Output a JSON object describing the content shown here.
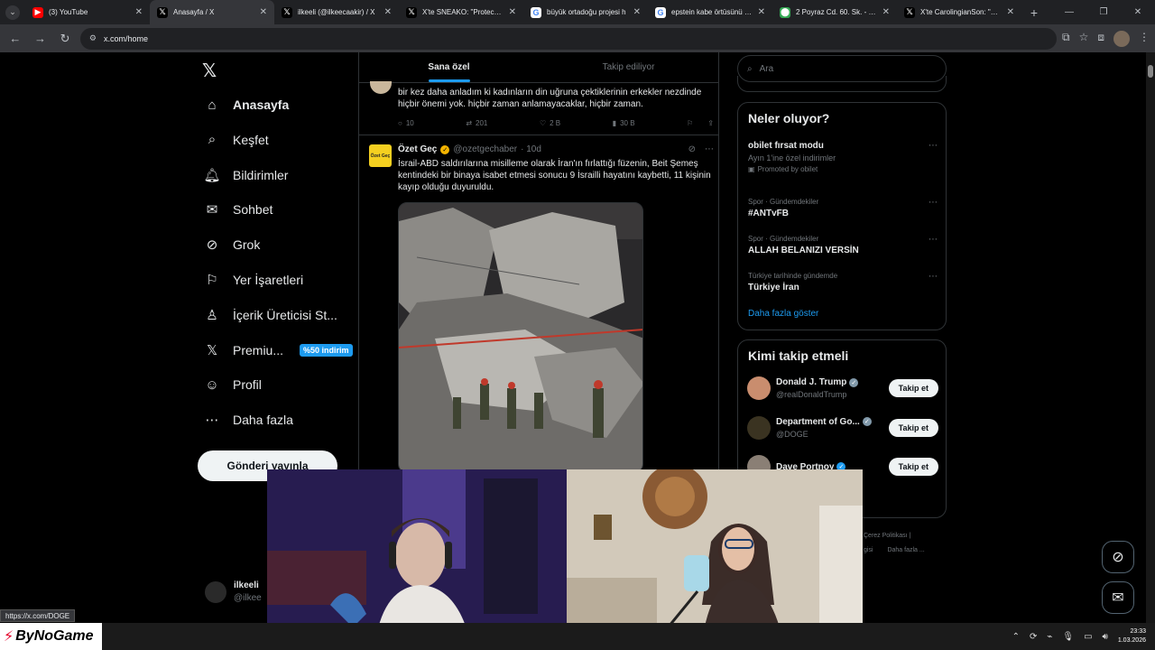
{
  "browser": {
    "tabs": [
      {
        "title": "(3) YouTube",
        "fav_color": "#ff0000",
        "fav_glyph": "▶",
        "active": false
      },
      {
        "title": "Anasayfa / X",
        "fav_color": "#000000",
        "fav_glyph": "𝕏",
        "active": true
      },
      {
        "title": "ilkeeli (@ilkeecaakir) / X",
        "fav_color": "#000000",
        "fav_glyph": "𝕏",
        "active": false
      },
      {
        "title": "X'te SNEAKO: \"Protect Tu",
        "fav_color": "#000000",
        "fav_glyph": "𝕏",
        "active": false
      },
      {
        "title": "büyük ortadoğu projesi h",
        "fav_color": "#ffffff",
        "fav_glyph": "G",
        "active": false
      },
      {
        "title": "epstein kabe örtüsünü kim",
        "fav_color": "#ffffff",
        "fav_glyph": "G",
        "active": false
      },
      {
        "title": "2 Poyraz Cd. 60. Sk. - Goo",
        "fav_color": "#34a853",
        "fav_glyph": "⬤",
        "active": false
      },
      {
        "title": "X'te CarolingianSon: \"@El",
        "fav_color": "#000000",
        "fav_glyph": "𝕏",
        "active": false
      }
    ],
    "url": "x.com/home"
  },
  "nav": {
    "logo": "𝕏",
    "items": [
      {
        "label": "Anasayfa",
        "icon": "⌂"
      },
      {
        "label": "Keşfet",
        "icon": "⌕"
      },
      {
        "label": "Bildirimler",
        "icon": "🔔︎"
      },
      {
        "label": "Sohbet",
        "icon": "✉"
      },
      {
        "label": "Grok",
        "icon": "⊘"
      },
      {
        "label": "Yer İşaretleri",
        "icon": "⚐"
      },
      {
        "label": "İçerik Üreticisi St...",
        "icon": "♙"
      },
      {
        "label": "Premiu...",
        "icon": "𝕏"
      },
      {
        "label": "Profil",
        "icon": "☺"
      },
      {
        "label": "Daha fazla",
        "icon": "⋯"
      }
    ],
    "premium_badge": "%50 indirim",
    "post_button": "Gönderi yayınla",
    "account_name": "ilkeeli",
    "account_handle": "@ilkee"
  },
  "feed": {
    "tabs": [
      "Sana özel",
      "Takip ediliyor"
    ],
    "prev_tweet": {
      "text": "bir kez daha anladım ki kadınların din uğruna çektiklerinin erkekler nezdinde hiçbir önemi yok. hiçbir zaman anlamayacaklar, hiçbir zaman.",
      "replies": "10",
      "reposts": "201",
      "likes": "2 B",
      "views": "30 B"
    },
    "tweet": {
      "avatar_text": "Özet Geç",
      "name": "Özet Geç",
      "handle": "@ozetgechaber",
      "time": "· 10d",
      "text": "İsrail-ABD saldırılarına misilleme olarak İran'ın fırlattığı füzenin, Beit Şemeş kentindeki bir binaya isabet etmesi sonucu 9 İsrailli hayatını kaybetti, 11 kişinin kayıp olduğu duyuruldu."
    }
  },
  "right": {
    "search_placeholder": "Ara",
    "trends_title": "Neler oluyor?",
    "trends": [
      {
        "cat": "",
        "name": "obilet fırsat modu",
        "sub": "Ayın 1'ine özel indirimler",
        "promo": "Promoted by obilet"
      },
      {
        "cat": "Spor · Gündemdekiler",
        "name": "#ANTvFB",
        "sub": "",
        "promo": ""
      },
      {
        "cat": "Spor · Gündemdekiler",
        "name": "ALLAH BELANIZI VERSİN",
        "sub": "",
        "promo": ""
      },
      {
        "cat": "Türkiye tarihinde gündemde",
        "name": "Türkiye İran",
        "sub": "",
        "promo": ""
      }
    ],
    "show_more": "Daha fazla göster",
    "who_title": "Kimi takip etmeli",
    "follow_label": "Takip et",
    "follows": [
      {
        "name": "Donald J. Trump",
        "handle": "@realDonaldTrump",
        "badge": "grey",
        "fav_color": "#c98d6e"
      },
      {
        "name": "Department of Go...",
        "handle": "@DOGE",
        "badge": "grey",
        "fav_color": "#3a3321"
      },
      {
        "name": "Dave Portnoy",
        "handle": "",
        "badge": "blue",
        "fav_color": "#8a7f75"
      }
    ],
    "footer": [
      "Çerez Politikası",
      "|",
      "gisi",
      "Daha fazla ..."
    ]
  },
  "status_url": "https://x.com/DOGE",
  "taskbar": {
    "logo": "ByNoGame",
    "time": "23:33",
    "date": "1.03.2026"
  }
}
